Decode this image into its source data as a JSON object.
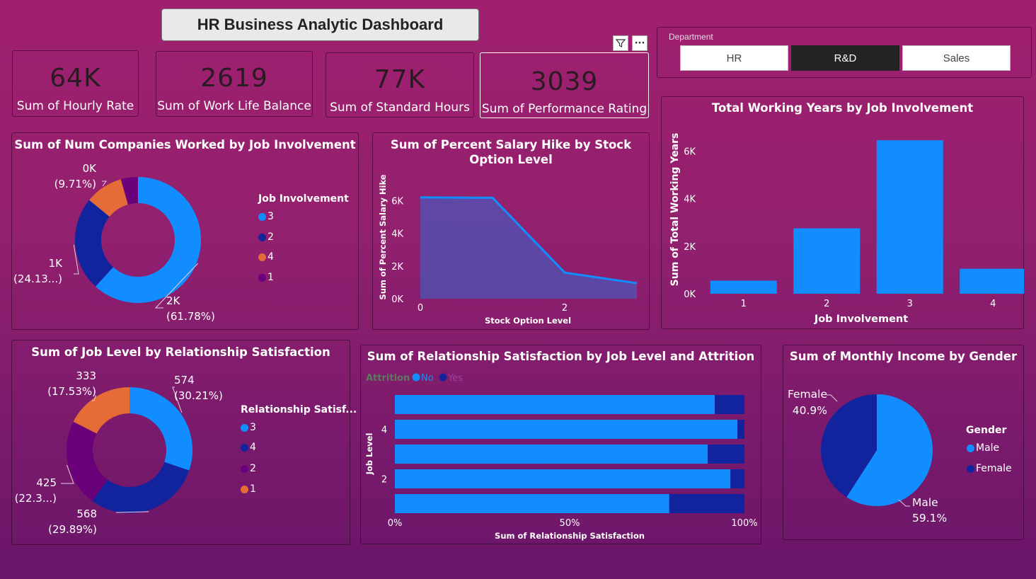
{
  "dashboard_title": "HR Business Analytic Dashboard",
  "kpis": [
    {
      "value": "64K",
      "label": "Sum of Hourly Rate"
    },
    {
      "value": "2619",
      "label": "Sum of Work Life Balance"
    },
    {
      "value": "77K",
      "label": "Sum of Standard Hours"
    },
    {
      "value": "3039",
      "label": "Sum of Performance Rating"
    }
  ],
  "slicer": {
    "title": "Department",
    "options": [
      "HR",
      "R&D",
      "Sales"
    ],
    "selected": "R&D"
  },
  "visual_header": {
    "filter_icon": "filter-icon",
    "more_icon": "more-options-icon",
    "more_glyph": "···"
  },
  "colors": {
    "blue": "#118dff",
    "navy": "#12239e",
    "orange": "#e66c37",
    "purple": "#6b007b",
    "selected_slicer": "#252423"
  },
  "chart_data": [
    {
      "type": "donut",
      "title": "Sum of Num Companies Worked by Job Involvement",
      "legend_title": "Job Involvement",
      "legend": [
        "3",
        "2",
        "4",
        "1"
      ],
      "slices": [
        {
          "name": "3",
          "value": 61.78,
          "label": "2K",
          "pct": "(61.78%)",
          "color": "#118dff"
        },
        {
          "name": "2",
          "value": 24.13,
          "label": "1K",
          "pct": "(24.13...)",
          "color": "#12239e"
        },
        {
          "name": "4",
          "value": 9.71,
          "label": "0K",
          "pct": "(9.71%)",
          "color": "#e66c37"
        },
        {
          "name": "1",
          "value": 4.38,
          "color": "#6b007b"
        }
      ]
    },
    {
      "type": "area",
      "title": "Sum of Percent Salary Hike by Stock Option Level",
      "xlabel": "Stock Option Level",
      "ylabel": "Sum of Percent Salary Hike",
      "x": [
        0,
        1,
        2,
        3
      ],
      "x_ticks": [
        "0",
        "2"
      ],
      "y": [
        6200,
        6180,
        1600,
        950
      ],
      "y_ticks": [
        "0K",
        "2K",
        "4K",
        "6K"
      ],
      "ylim": [
        0,
        6500
      ]
    },
    {
      "type": "bar",
      "title": "Total Working Years by Job Involvement",
      "xlabel": "Job Involvement",
      "ylabel": "Sum of Total Working Years",
      "categories": [
        "1",
        "2",
        "3",
        "4"
      ],
      "values": [
        550,
        2750,
        6450,
        1050
      ],
      "y_ticks": [
        "0K",
        "2K",
        "4K",
        "6K"
      ],
      "ylim": [
        0,
        6900
      ]
    },
    {
      "type": "donut",
      "title": "Sum of Job Level by Relationship Satisfaction",
      "legend_title": "Relationship Satisf...",
      "legend": [
        "3",
        "4",
        "2",
        "1"
      ],
      "slices": [
        {
          "name": "3",
          "value": 30.21,
          "label": "574",
          "pct": "(30.21%)",
          "color": "#118dff"
        },
        {
          "name": "4",
          "value": 29.89,
          "label": "568",
          "pct": "(29.89%)",
          "color": "#12239e"
        },
        {
          "name": "2",
          "value": 22.37,
          "label": "425",
          "pct": "(22.3...)",
          "color": "#6b007b"
        },
        {
          "name": "1",
          "value": 17.53,
          "label": "333",
          "pct": "(17.53%)",
          "color": "#e66c37"
        }
      ]
    },
    {
      "type": "bar",
      "title": "Sum of Relationship Satisfaction by Job Level and Attrition",
      "orientation": "horizontal-100%-stacked",
      "xlabel": "Sum of Relationship Satisfaction",
      "ylabel": "Job Level",
      "legend_title": "Attrition",
      "legend": [
        "No",
        "Yes"
      ],
      "categories": [
        "5",
        "4",
        "3",
        "2",
        "1"
      ],
      "y_tick_labels": {
        "4": "4",
        "2": "2"
      },
      "series": [
        {
          "name": "No",
          "values": [
            91.5,
            98,
            89.5,
            96,
            78.5
          ]
        },
        {
          "name": "Yes",
          "values": [
            8.5,
            2,
            10.5,
            4,
            21.5
          ]
        }
      ],
      "x_ticks": [
        "0%",
        "50%",
        "100%"
      ]
    },
    {
      "type": "pie",
      "title": "Sum of Monthly Income by Gender",
      "legend_title": "Gender",
      "legend": [
        "Male",
        "Female"
      ],
      "slices": [
        {
          "name": "Male",
          "value": 59.1,
          "label": "Male",
          "pct": "59.1%",
          "color": "#118dff"
        },
        {
          "name": "Female",
          "value": 40.9,
          "label": "Female",
          "pct": "40.9%",
          "color": "#12239e"
        }
      ]
    }
  ]
}
